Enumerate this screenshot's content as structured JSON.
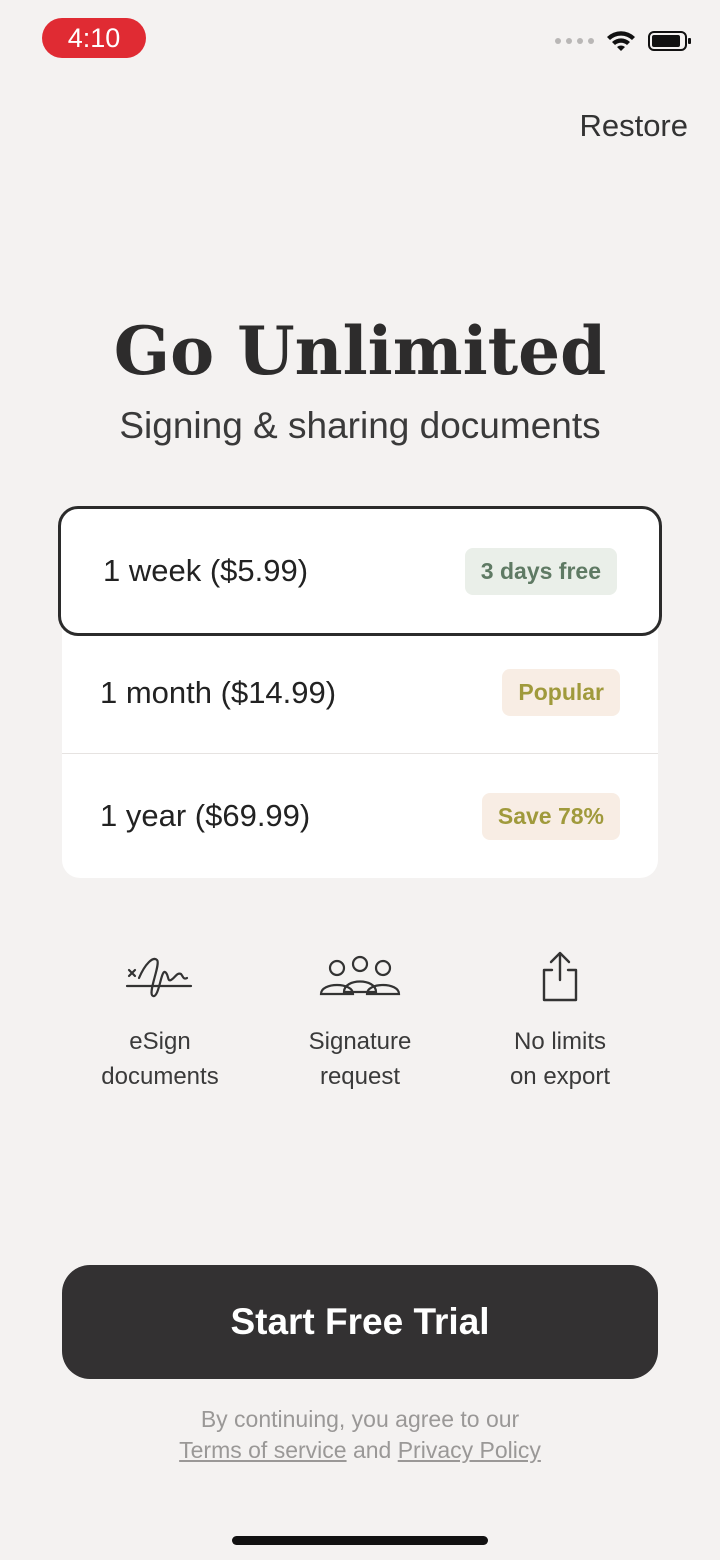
{
  "status": {
    "time": "4:10",
    "accent": "#e02b33"
  },
  "header": {
    "restore_label": "Restore"
  },
  "hero": {
    "title": "Go Unlimited",
    "subtitle": "Signing & sharing documents"
  },
  "plans": [
    {
      "label": "1 week ($5.99)",
      "badge": "3 days free",
      "selected": true
    },
    {
      "label": "1 month ($14.99)",
      "badge": "Popular",
      "selected": false
    },
    {
      "label": "1 year ($69.99)",
      "badge": "Save 78%",
      "selected": false
    }
  ],
  "features": [
    {
      "icon": "signature-icon",
      "text": "eSign\ndocuments"
    },
    {
      "icon": "people-icon",
      "text": "Signature\nrequest"
    },
    {
      "icon": "share-icon",
      "text": "No limits\non export"
    }
  ],
  "cta": {
    "label": "Start Free Trial",
    "color": "#333132"
  },
  "legal": {
    "line1": "By continuing, you agree to our",
    "terms": "Terms of service",
    "and": "and",
    "privacy": "Privacy Policy"
  }
}
